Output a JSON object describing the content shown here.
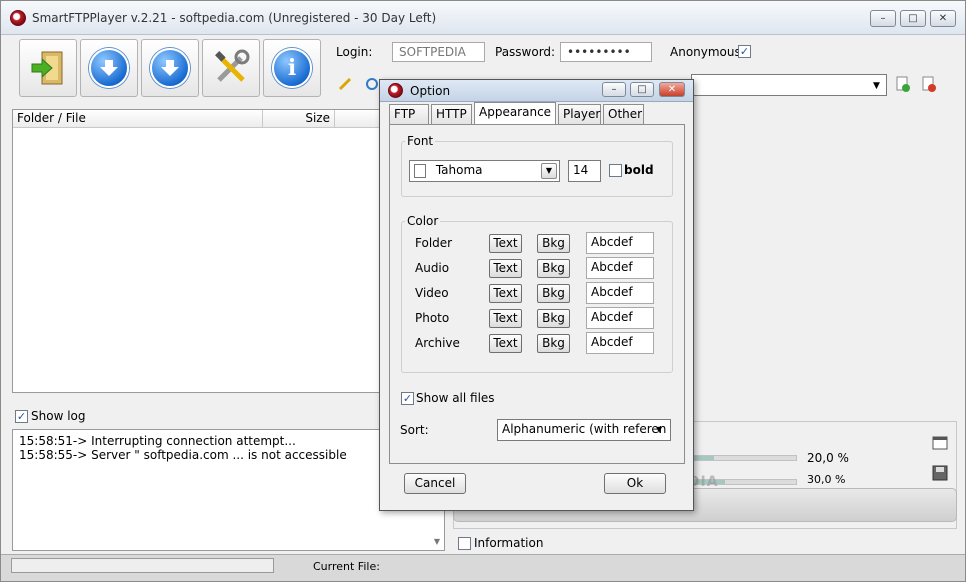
{
  "window": {
    "title": "SmartFTPPlayer v.2.21 - softpedia.com (Unregistered - 30 Day Left)",
    "controls": {
      "minimize": "–",
      "maximize": "□",
      "close": "✕"
    }
  },
  "toolbar": {
    "buttons": [
      {
        "name": "connect",
        "icon": "door-arrow-icon"
      },
      {
        "name": "download",
        "icon": "down-arrow-icon"
      },
      {
        "name": "download-all",
        "icon": "down-arrow-icon"
      },
      {
        "name": "settings",
        "icon": "tools-icon"
      },
      {
        "name": "about",
        "icon": "info-icon"
      }
    ],
    "login_label": "Login:",
    "login_value": "SOFTPEDIA",
    "password_label": "Password:",
    "password_value": "•••••••••",
    "anonymous_label": "Anonymous",
    "anonymous_checked": true
  },
  "file_list": {
    "columns": [
      "Folder / File",
      "Size"
    ]
  },
  "log": {
    "show_log_label": "Show log",
    "show_log_checked": true,
    "lines": [
      "15:58:51-> Interrupting connection attempt...",
      "15:58:55-> Server \" softpedia.com ... is not accessible"
    ]
  },
  "right_panel": {
    "progress": [
      {
        "label": "20,0 %",
        "fraction": 0.2
      },
      {
        "label": "30,0 %",
        "fraction": 0.3
      }
    ],
    "information_label": "Information"
  },
  "status_bar": {
    "current_file_label": "Current File:"
  },
  "dialog": {
    "title": "Option",
    "tabs": [
      "FTP",
      "HTTP",
      "Appearance",
      "Player",
      "Other"
    ],
    "active_tab": "Appearance",
    "font_group": {
      "title": "Font",
      "font_name": "Tahoma",
      "font_size": "14",
      "bold_label": "bold",
      "bold_checked": false
    },
    "color_group": {
      "title": "Color",
      "text_btn": "Text",
      "bkg_btn": "Bkg",
      "rows": [
        {
          "label": "Folder",
          "sample": "Abcdef"
        },
        {
          "label": "Audio",
          "sample": "Abcdef"
        },
        {
          "label": "Video",
          "sample": "Abcdef"
        },
        {
          "label": "Photo",
          "sample": "Abcdef"
        },
        {
          "label": "Archive",
          "sample": "Abcdef"
        }
      ]
    },
    "show_all_files_label": "Show all files",
    "show_all_files_checked": true,
    "sort_label": "Sort:",
    "sort_value": "Alphanumeric (with referen",
    "cancel_label": "Cancel",
    "ok_label": "Ok"
  },
  "watermark": "SOFTPEDIA"
}
